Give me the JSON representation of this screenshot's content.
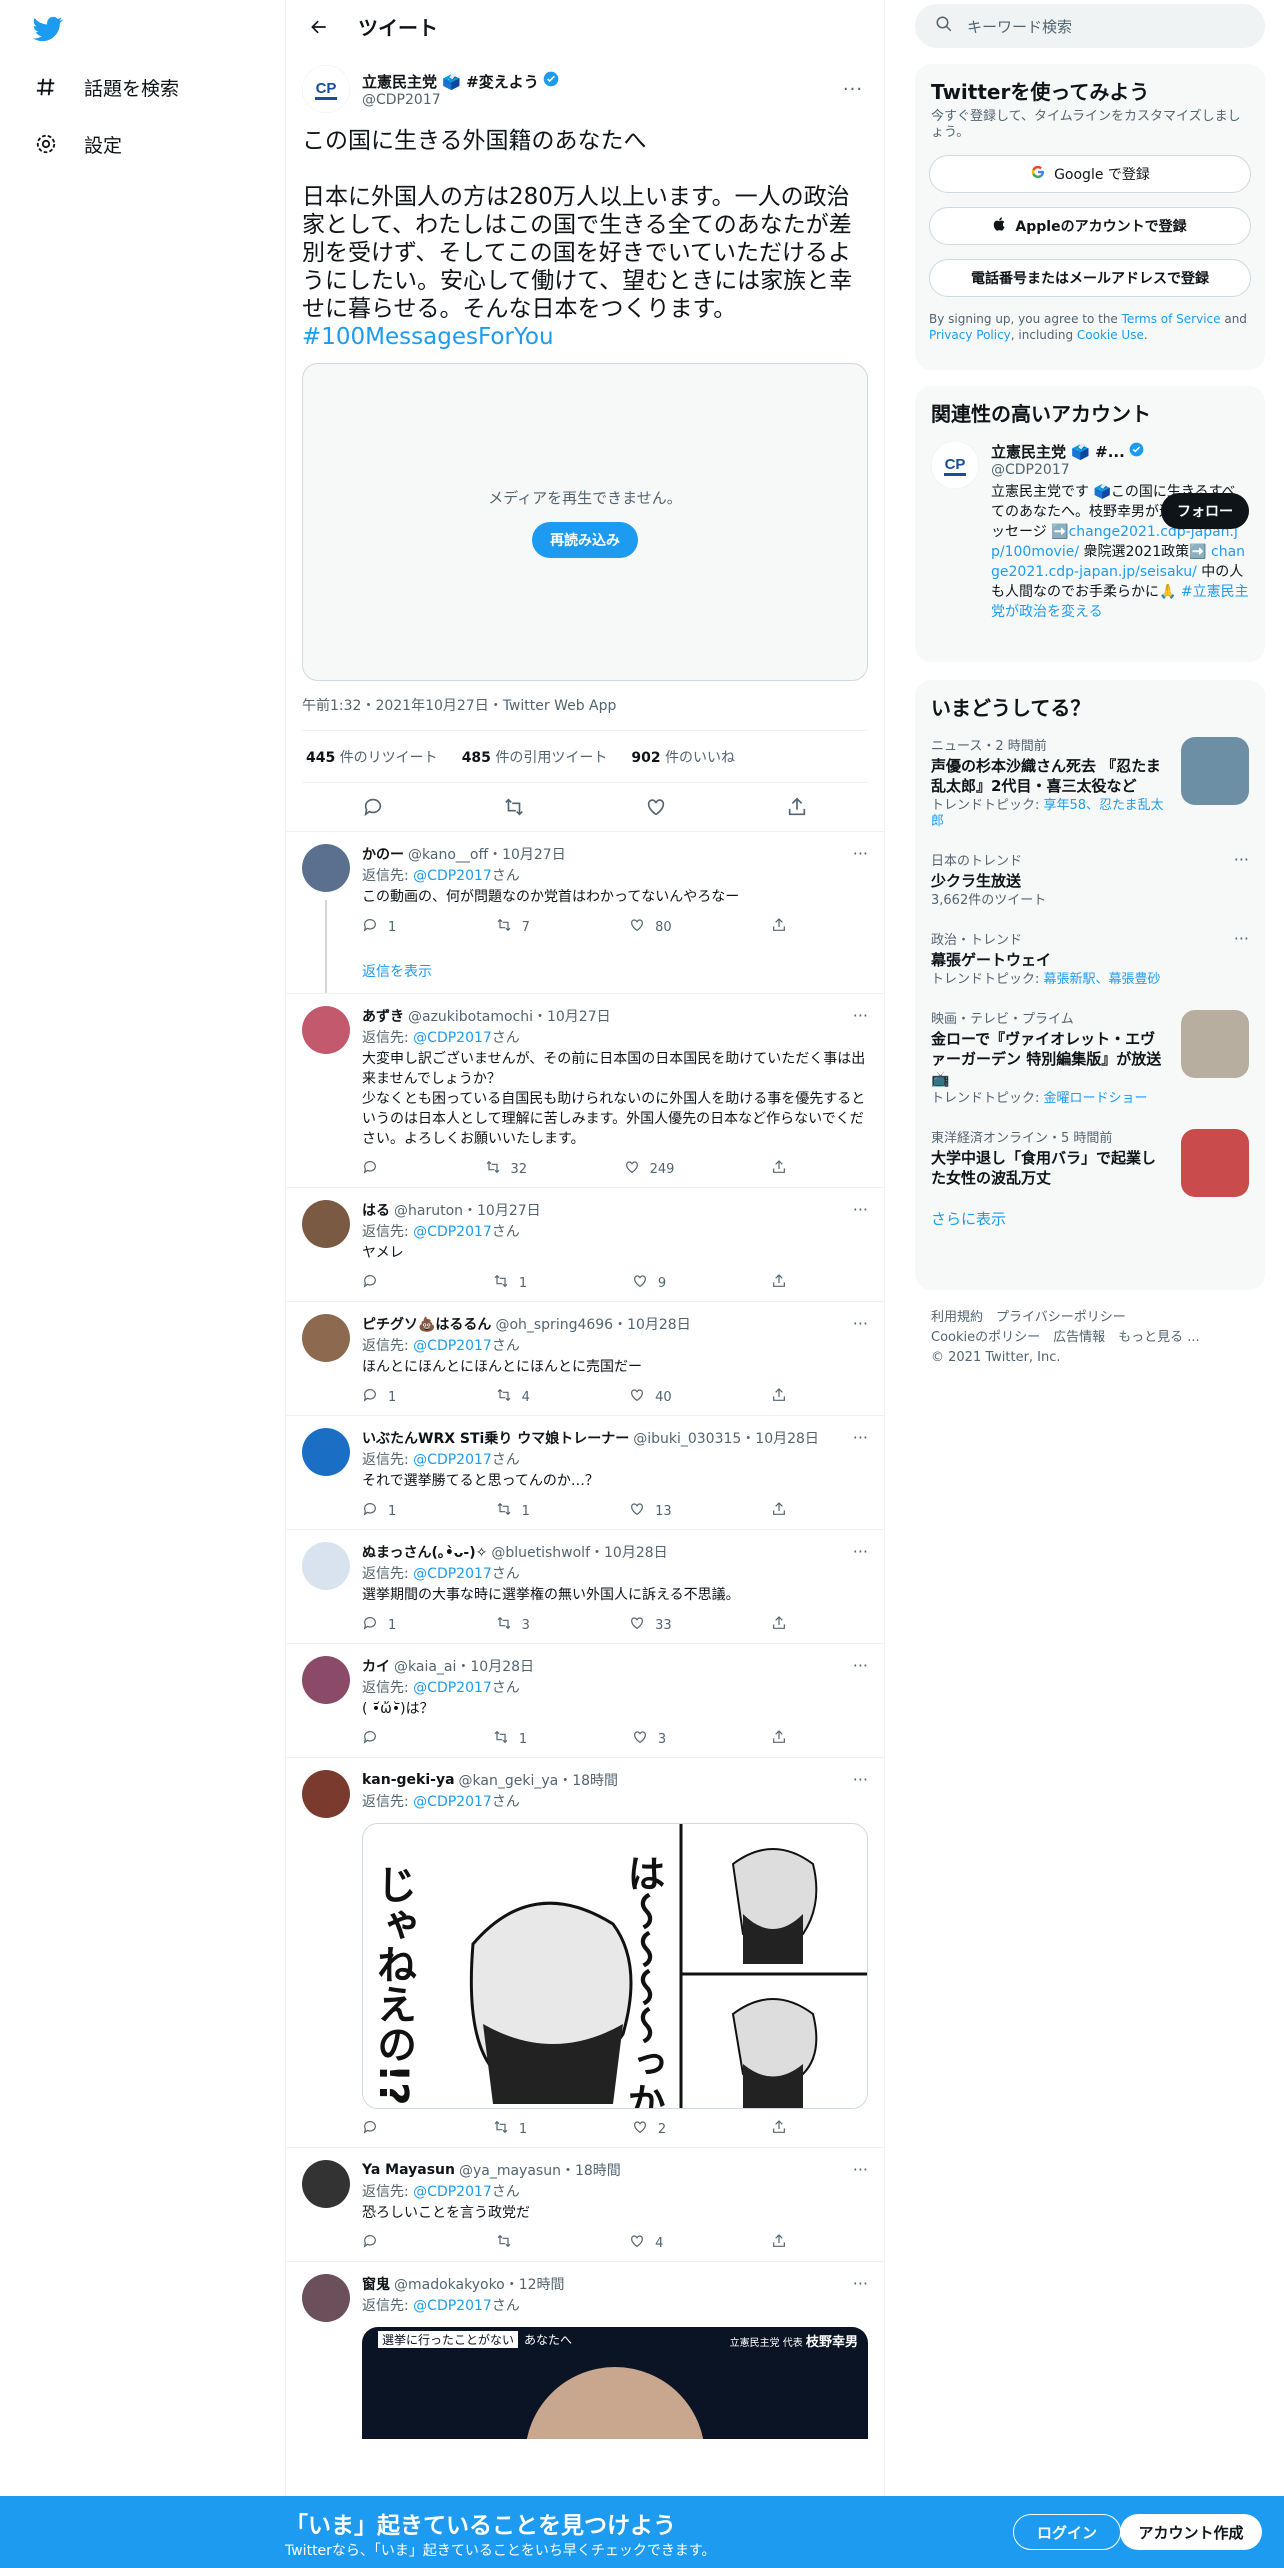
{
  "nav": {
    "explore": "話題を検索",
    "settings": "設定"
  },
  "header": {
    "title": "ツイート"
  },
  "tweet": {
    "name": "立憲民主党 🗳️ #変えよう",
    "handle": "@CDP2017",
    "text": "この国に生きる外国籍のあなたへ\n\n日本に外国人の方は280万人以上います。一人の政治家として、わたしはこの国で生きる全てのあなたが差別を受けず、そしてこの国を好きでいていただけるようにしたい。安心して働けて、望むときには家族と幸せに暮らせる。そんな日本をつくります。",
    "hashtag": "#100MessagesForYou",
    "media_msg": "メディアを再生できません。",
    "reload": "再読み込み",
    "meta": "午前1:32・2021年10月27日・Twitter Web App",
    "retweets": "445",
    "retweets_label": "件のリツイート",
    "quotes": "485",
    "quotes_label": "件の引用ツイート",
    "likes": "902",
    "likes_label": "件のいいね"
  },
  "replies": [
    {
      "name": "かのー",
      "handle": "@kano__off・10月27日",
      "to": "返信先: ",
      "to_link": "@CDP2017",
      "to_suffix": "さん",
      "text": "この動画の、何が問題なのか党首はわかってないんやろなー",
      "reply": "1",
      "rt": "7",
      "like": "80",
      "show": "返信を表示"
    },
    {
      "name": "あずき",
      "handle": "@azukibotamochi・10月27日",
      "to": "返信先: ",
      "to_link": "@CDP2017",
      "to_suffix": "さん",
      "text": "大変申し訳ございませんが、その前に日本国の日本国民を助けていただく事は出来ませんでしょうか？\n少なくとも困っている自国民も助けられないのに外国人を助ける事を優先するというのは日本人として理解に苦しみます。外国人優先の日本など作らないでください。よろしくお願いいたします。",
      "reply": "",
      "rt": "32",
      "like": "249"
    },
    {
      "name": "はる",
      "handle": "@haruton・10月27日",
      "to": "返信先: ",
      "to_link": "@CDP2017",
      "to_suffix": "さん",
      "text": "ヤメレ",
      "reply": "",
      "rt": "1",
      "like": "9"
    },
    {
      "name": "ピチグソ💩はるるん",
      "handle": "@oh_spring4696・10月28日",
      "to": "返信先: ",
      "to_link": "@CDP2017",
      "to_suffix": "さん",
      "text": "ほんとにほんとにほんとにほんとに売国だー",
      "reply": "1",
      "rt": "4",
      "like": "40"
    },
    {
      "name": "いぶたんWRX STi乗り ウマ娘トレーナー",
      "handle": "@ibuki_030315・10月28日",
      "to": "返信先: ",
      "to_link": "@CDP2017",
      "to_suffix": "さん",
      "text": "それで選挙勝てると思ってんのか…？",
      "reply": "1",
      "rt": "1",
      "like": "13"
    },
    {
      "name": "ぬまっさん(｡•̀ᴗ-)✧",
      "handle": "@bluetishwolf・10月28日",
      "to": "返信先: ",
      "to_link": "@CDP2017",
      "to_suffix": "さん",
      "text": "選挙期間の大事な時に選挙権の無い外国人に訴える不思議。",
      "reply": "1",
      "rt": "3",
      "like": "33"
    },
    {
      "name": "カイ",
      "handle": "@kaia_ai・10月28日",
      "to": "返信先: ",
      "to_link": "@CDP2017",
      "to_suffix": "さん",
      "text": "( •᷄ὤ•᷅)は？",
      "reply": "",
      "rt": "1",
      "like": "3"
    },
    {
      "name": "kan-geki-ya",
      "handle": "@kan_geki_ya・18時間",
      "to": "返信先: ",
      "to_link": "@CDP2017",
      "to_suffix": "さん",
      "text": "",
      "manga": "は〜〜〜〜っか\nじゃねえの!?",
      "reply": "",
      "rt": "1",
      "like": "2"
    },
    {
      "name": "Ya Mayasun",
      "handle": "@ya_mayasun・18時間",
      "to": "返信先: ",
      "to_link": "@CDP2017",
      "to_suffix": "さん",
      "text": "恐ろしいことを言う政党だ",
      "reply": "",
      "rt": "",
      "like": "4"
    },
    {
      "name": "窗鬼",
      "handle": "@madokakyoko・12時間",
      "to": "返信先: ",
      "to_link": "@CDP2017",
      "to_suffix": "さん",
      "text": "",
      "banner_left": "選挙に行ったことがない",
      "banner_mid": "あなたへ",
      "banner_right": "立憲民主党 代表",
      "banner_name": "枝野幸男"
    }
  ],
  "right": {
    "search_placeholder": "キーワード検索",
    "signup": {
      "title": "Twitterを使ってみよう",
      "sub": "今すぐ登録して、タイムラインをカスタマイズしましょう。",
      "google": "Google で登録",
      "apple": "Appleのアカウントで登録",
      "phone": "電話番号またはメールアドレスで登録",
      "terms1": "By signing up, you agree to the ",
      "terms_link": "Terms of Service",
      "terms2": " and ",
      "privacy": "Privacy Policy",
      "terms3": ", including ",
      "cookie": "Cookie Use",
      "terms4": "."
    },
    "related": {
      "title": "関連性の高いアカウント",
      "name": "立憲民主党 🗳️ #...",
      "handle": "@CDP2017",
      "follow": "フォロー",
      "bio1": "立憲民主党です 🗳️この国に生きるすべてのあなたへ。枝野幸男が送る100のメッセージ ➡️",
      "bio_l1": "change2021.cdp-japan.jp/100movie/",
      "bio2": " 衆院選2021政策➡️ ",
      "bio_l2": "change2021.cdp-japan.jp/seisaku/",
      "bio3": " 中の人も人間なのでお手柔らかに🙏 ",
      "bio_l3": "#立憲民主党が政治を変える"
    },
    "trends": {
      "title": "いまどうしてる？",
      "more": "さらに表示",
      "items": [
        {
          "meta": "ニュース・2 時間前",
          "title": "声優の杉本沙織さん死去 『忍たま乱太郎』2代目・喜三太役など",
          "trend_label": "トレンドトピック: ",
          "trend_links": "享年58、忍たま乱太郎"
        },
        {
          "meta": "日本のトレンド",
          "title": "少クラ生放送",
          "sub": "3,662件のツイート"
        },
        {
          "meta": "政治・トレンド",
          "title": "幕張ゲートウェイ",
          "trend_label": "トレンドトピック: ",
          "trend_links": "幕張新駅、幕張豊砂"
        },
        {
          "meta": "映画・テレビ・プライム",
          "title": "金ローで『ヴァイオレット・エヴァーガーデン 特別編集版』が放送📺",
          "trend_label": "トレンドトピック: ",
          "trend_links": "金曜ロードショー"
        },
        {
          "meta": "東洋経済オンライン・5 時間前",
          "title": "大学中退し「食用バラ」で起業した女性の波乱万丈"
        }
      ]
    },
    "footer": {
      "line1": "利用規約　プライバシーポリシー",
      "line2": "Cookieのポリシー　広告情報　もっと見る ...",
      "line3": "© 2021 Twitter, Inc."
    }
  },
  "bottom": {
    "title": "「いま」起きていることを見つけよう",
    "sub": "Twitterなら、「いま」起きていることをいち早くチェックできます。",
    "login": "ログイン",
    "signup": "アカウント作成"
  },
  "colors": {
    "accent": "#1d9bf0"
  }
}
